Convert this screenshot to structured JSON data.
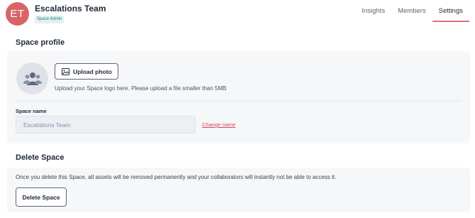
{
  "header": {
    "avatar_initials": "ET",
    "avatar_color": "#d96467",
    "team_name": "Escalations Team",
    "role_badge": "Space Admin",
    "tabs": [
      {
        "label": "Insights",
        "active": false
      },
      {
        "label": "Members",
        "active": false
      },
      {
        "label": "Settings",
        "active": true
      }
    ],
    "active_tab_color": "#e36b7c"
  },
  "profile": {
    "title": "Space profile",
    "logo_icon": "group-icon",
    "upload_label": "Upload photo",
    "upload_icon": "image-icon",
    "upload_hint": "Upload your Space logo here. Please upload a file smaller than 5MB",
    "name_label": "Space name",
    "name_value": "Escalations Team",
    "change_name_label": "Change name",
    "link_color": "#d34a5e"
  },
  "delete": {
    "title": "Delete Space",
    "description": "Once you delete this Space, all assets will be removed permanently and your collaborators will instantly not be able to access it.",
    "button_label": "Delete Space"
  }
}
